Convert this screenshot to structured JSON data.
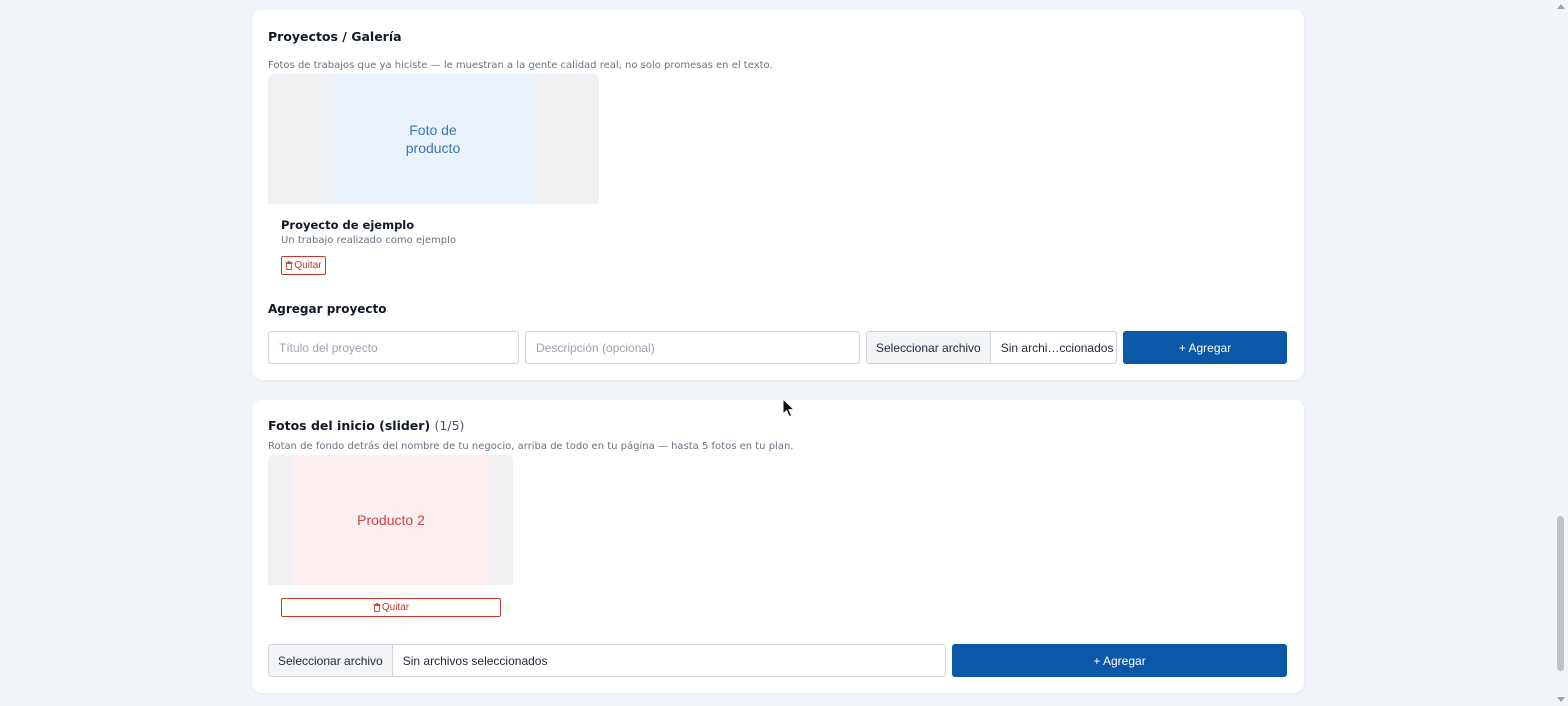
{
  "projects": {
    "title": "Proyectos / Galería",
    "description": "Fotos de trabajos que ya hiciste — le muestran a la gente calidad real, no solo promesas en el texto.",
    "items": [
      {
        "image_text": "Foto de\nproducto",
        "image_color": "#eaf2fb",
        "image_text_color": "#3b77b8",
        "title": "Proyecto de ejemplo",
        "description": "Un trabajo realizado como ejemplo",
        "remove_label": "Quitar"
      }
    ],
    "add": {
      "title": "Agregar proyecto",
      "title_placeholder": "Título del proyecto",
      "description_placeholder": "Descripción (opcional)",
      "file_button": "Seleccionar archivo",
      "file_status": "Sin archi…ccionados",
      "submit_label": "+ Agregar"
    }
  },
  "slider": {
    "title": "Fotos del inicio (slider)",
    "count": "(1/5)",
    "description": "Rotan de fondo detrás del nombre de tu negocio, arriba de todo en tu página — hasta 5 fotos en tu plan.",
    "items": [
      {
        "image_text": "Producto 2",
        "image_color": "#fcefef",
        "image_text_color": "#cf4444",
        "remove_label": "Quitar"
      }
    ],
    "add": {
      "file_button": "Seleccionar archivo",
      "file_status": "Sin archivos seleccionados",
      "submit_label": "+ Agregar"
    }
  },
  "colors": {
    "primary": "#0b57a8",
    "danger": "#c0392b",
    "background": "#f1f5f9"
  }
}
